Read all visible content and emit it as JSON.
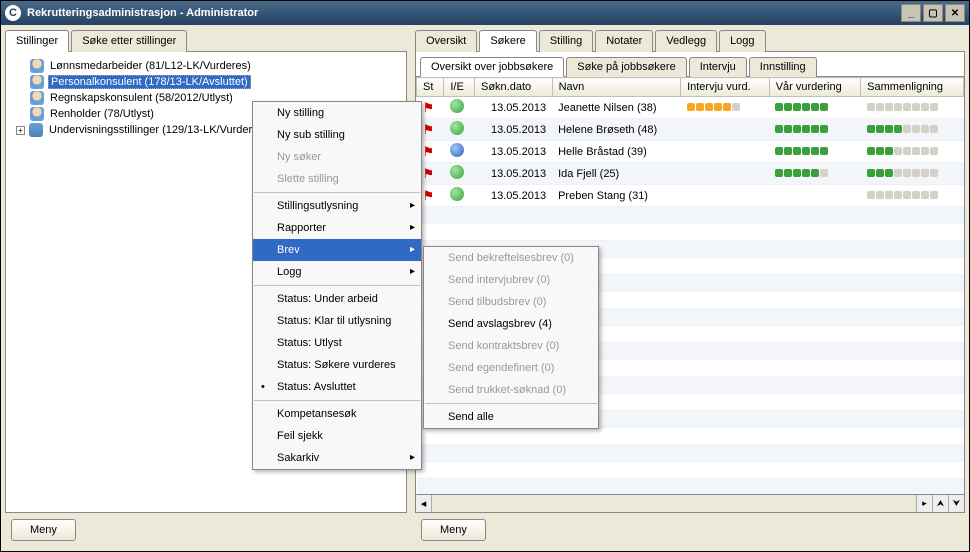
{
  "title": "Rekrutteringsadministrasjon - Administrator",
  "leftTabs": [
    {
      "label": "Stillinger",
      "active": true
    },
    {
      "label": "Søke etter stillinger",
      "active": false
    }
  ],
  "tree": [
    {
      "label": "Lønnsmedarbeider (81/L12-LK/Vurderes)",
      "icon": "user",
      "selected": false
    },
    {
      "label": "Personalkonsulent (178/13-LK/Avsluttet)",
      "icon": "user",
      "selected": true
    },
    {
      "label": "Regnskapskonsulent (58/2012/Utlyst)",
      "icon": "user",
      "selected": false
    },
    {
      "label": "Renholder (78/Utlyst)",
      "icon": "user",
      "selected": false
    },
    {
      "label": "Undervisningsstillinger (129/13-LK/Vurderes)",
      "icon": "users",
      "selected": false,
      "expandable": true
    }
  ],
  "menuButton": "Meny",
  "rightTabs": [
    {
      "label": "Oversikt",
      "active": false
    },
    {
      "label": "Søkere",
      "active": true
    },
    {
      "label": "Stilling",
      "active": false
    },
    {
      "label": "Notater",
      "active": false
    },
    {
      "label": "Vedlegg",
      "active": false
    },
    {
      "label": "Logg",
      "active": false
    }
  ],
  "subTabs": [
    {
      "label": "Oversikt over jobbsøkere",
      "active": true
    },
    {
      "label": "Søke på jobbsøkere",
      "active": false
    },
    {
      "label": "Intervju",
      "active": false
    },
    {
      "label": "Innstilling",
      "active": false
    }
  ],
  "columns": [
    "St",
    "I/E",
    "Søkn.dato",
    "Navn",
    "Intervju vurd.",
    "Vår vurdering",
    "Sammenligning"
  ],
  "rows": [
    {
      "flag": true,
      "globe": "green",
      "date": "13.05.2013",
      "name": "Jeanette Nilsen (38)",
      "iv": [
        5,
        "orange"
      ],
      "vv": [
        6,
        "green"
      ],
      "cmp": 0
    },
    {
      "flag": true,
      "globe": "green",
      "date": "13.05.2013",
      "name": "Helene Brøseth (48)",
      "iv": [
        0,
        ""
      ],
      "vv": [
        6,
        "green"
      ],
      "cmp": 4
    },
    {
      "flag": true,
      "globe": "blue",
      "date": "13.05.2013",
      "name": "Helle Bråstad (39)",
      "iv": [
        0,
        ""
      ],
      "vv": [
        6,
        "green"
      ],
      "cmp": 3
    },
    {
      "flag": true,
      "globe": "green",
      "date": "13.05.2013",
      "name": "Ida Fjell (25)",
      "iv": [
        0,
        ""
      ],
      "vv": [
        5,
        "green"
      ],
      "cmp": 3
    },
    {
      "flag": true,
      "globe": "green",
      "date": "13.05.2013",
      "name": "Preben Stang (31)",
      "iv": [
        0,
        ""
      ],
      "vv": [
        0,
        ""
      ],
      "cmp": 0
    }
  ],
  "contextMenu": [
    {
      "label": "Ny stilling"
    },
    {
      "label": "Ny sub stilling"
    },
    {
      "label": "Ny søker",
      "disabled": true
    },
    {
      "label": "Slette stilling",
      "disabled": true
    },
    {
      "sep": true
    },
    {
      "label": "Stillingsutlysning",
      "arrow": true
    },
    {
      "label": "Rapporter",
      "arrow": true
    },
    {
      "label": "Brev",
      "arrow": true,
      "selected": true
    },
    {
      "label": "Logg",
      "arrow": true
    },
    {
      "sep": true
    },
    {
      "label": "Status: Under arbeid"
    },
    {
      "label": "Status: Klar til utlysning"
    },
    {
      "label": "Status: Utlyst"
    },
    {
      "label": "Status: Søkere vurderes"
    },
    {
      "label": "Status: Avsluttet",
      "dot": true
    },
    {
      "sep": true
    },
    {
      "label": "Kompetansesøk"
    },
    {
      "label": "Feil sjekk"
    },
    {
      "label": "Sakarkiv",
      "arrow": true
    }
  ],
  "subMenu": [
    {
      "label": "Send bekreftelsesbrev (0)",
      "disabled": true
    },
    {
      "label": "Send intervjubrev (0)",
      "disabled": true
    },
    {
      "label": "Send tilbudsbrev (0)",
      "disabled": true
    },
    {
      "label": "Send avslagsbrev (4)"
    },
    {
      "label": "Send kontraktsbrev (0)",
      "disabled": true
    },
    {
      "label": "Send egendefinert (0)",
      "disabled": true
    },
    {
      "label": "Send trukket-søknad (0)",
      "disabled": true
    },
    {
      "sep": true
    },
    {
      "label": "Send alle"
    }
  ]
}
